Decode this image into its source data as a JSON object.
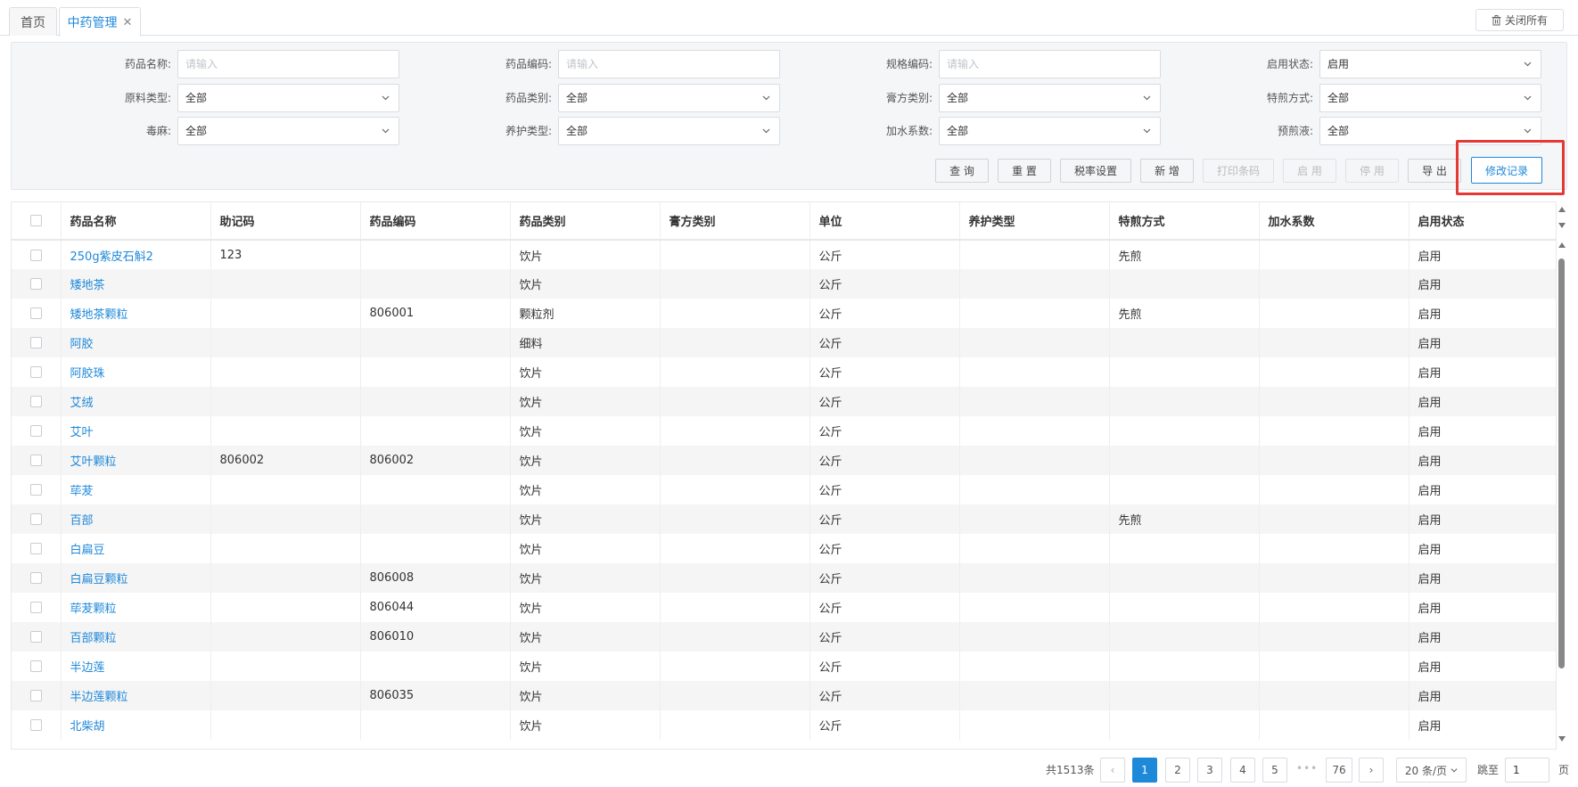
{
  "tabs": {
    "home": "首页",
    "current": "中药管理",
    "close_all": "关闭所有"
  },
  "filters": {
    "drug_name_label": "药品名称:",
    "drug_name_placeholder": "请输入",
    "drug_code_label": "药品编码:",
    "drug_code_placeholder": "请输入",
    "spec_code_label": "规格编码:",
    "spec_code_placeholder": "请输入",
    "enable_status_label": "启用状态:",
    "enable_status_value": "启用",
    "material_type_label": "原料类型:",
    "material_type_value": "全部",
    "drug_category_label": "药品类别:",
    "drug_category_value": "全部",
    "paste_category_label": "膏方类别:",
    "paste_category_value": "全部",
    "decoct_method_label": "特煎方式:",
    "decoct_method_value": "全部",
    "toxic_label": "毒麻:",
    "toxic_value": "全部",
    "care_type_label": "养护类型:",
    "care_type_value": "全部",
    "water_coef_label": "加水系数:",
    "water_coef_value": "全部",
    "pre_decoct_label": "预煎液:",
    "pre_decoct_value": "全部"
  },
  "actions": {
    "query": "查 询",
    "reset": "重 置",
    "tax_settings": "税率设置",
    "add": "新 增",
    "print_barcode": "打印条码",
    "enable": "启 用",
    "disable": "停 用",
    "export": "导 出",
    "change_log": "修改记录"
  },
  "table": {
    "headers": [
      "药品名称",
      "助记码",
      "药品编码",
      "药品类别",
      "膏方类别",
      "单位",
      "养护类型",
      "特煎方式",
      "加水系数",
      "启用状态"
    ],
    "rows": [
      [
        "250g紫皮石斛2",
        "123",
        "",
        "饮片",
        "",
        "公斤",
        "",
        "先煎",
        "",
        "启用"
      ],
      [
        "矮地茶",
        "",
        "",
        "饮片",
        "",
        "公斤",
        "",
        "",
        "",
        "启用"
      ],
      [
        "矮地茶颗粒",
        "",
        "806001",
        "颗粒剂",
        "",
        "公斤",
        "",
        "先煎",
        "",
        "启用"
      ],
      [
        "阿胶",
        "",
        "",
        "细料",
        "",
        "公斤",
        "",
        "",
        "",
        "启用"
      ],
      [
        "阿胶珠",
        "",
        "",
        "饮片",
        "",
        "公斤",
        "",
        "",
        "",
        "启用"
      ],
      [
        "艾绒",
        "",
        "",
        "饮片",
        "",
        "公斤",
        "",
        "",
        "",
        "启用"
      ],
      [
        "艾叶",
        "",
        "",
        "饮片",
        "",
        "公斤",
        "",
        "",
        "",
        "启用"
      ],
      [
        "艾叶颗粒",
        "806002",
        "806002",
        "饮片",
        "",
        "公斤",
        "",
        "",
        "",
        "启用"
      ],
      [
        "荜茇",
        "",
        "",
        "饮片",
        "",
        "公斤",
        "",
        "",
        "",
        "启用"
      ],
      [
        "百部",
        "",
        "",
        "饮片",
        "",
        "公斤",
        "",
        "先煎",
        "",
        "启用"
      ],
      [
        "白扁豆",
        "",
        "",
        "饮片",
        "",
        "公斤",
        "",
        "",
        "",
        "启用"
      ],
      [
        "白扁豆颗粒",
        "",
        "806008",
        "饮片",
        "",
        "公斤",
        "",
        "",
        "",
        "启用"
      ],
      [
        "荜茇颗粒",
        "",
        "806044",
        "饮片",
        "",
        "公斤",
        "",
        "",
        "",
        "启用"
      ],
      [
        "百部颗粒",
        "",
        "806010",
        "饮片",
        "",
        "公斤",
        "",
        "",
        "",
        "启用"
      ],
      [
        "半边莲",
        "",
        "",
        "饮片",
        "",
        "公斤",
        "",
        "",
        "",
        "启用"
      ],
      [
        "半边莲颗粒",
        "",
        "806035",
        "饮片",
        "",
        "公斤",
        "",
        "",
        "",
        "启用"
      ],
      [
        "北柴胡",
        "",
        "",
        "饮片",
        "",
        "公斤",
        "",
        "",
        "",
        "启用"
      ]
    ]
  },
  "pagination": {
    "total": "共1513条",
    "pages": [
      "1",
      "2",
      "3",
      "4",
      "5"
    ],
    "ellipsis": "•••",
    "last_page": "76",
    "page_size": "20 条/页",
    "jump_label": "跳至",
    "jump_value": "1",
    "page_suffix": "页",
    "prev": "‹",
    "next": "›"
  },
  "colors": {
    "accent": "#1e88d9",
    "highlight": "#e53935"
  }
}
